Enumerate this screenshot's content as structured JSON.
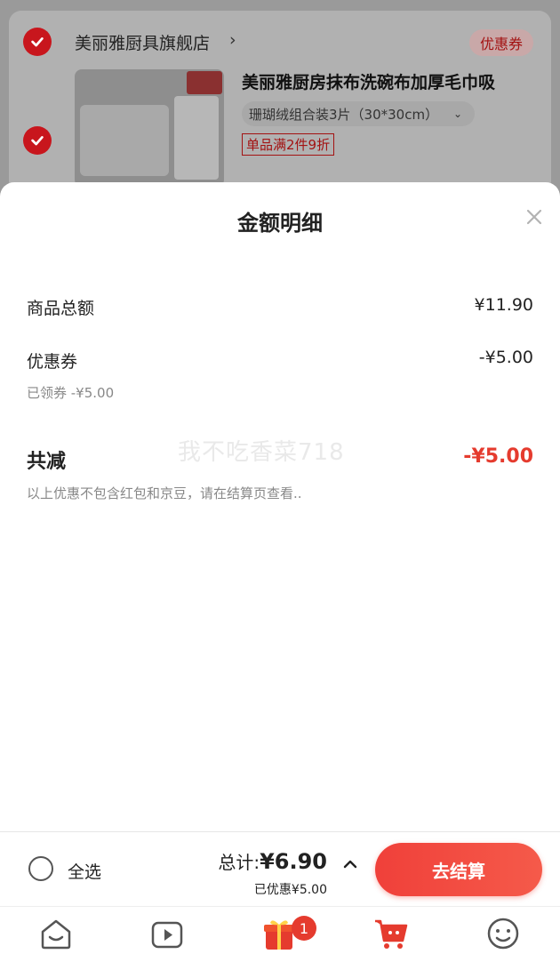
{
  "store": {
    "name": "美丽雅厨具旗舰店",
    "chevron": "›",
    "coupon_label": "优惠券"
  },
  "product": {
    "title": "美丽雅厨房抹布洗碗布加厚毛巾吸",
    "variant": "珊瑚绒组合装3片（30*30cm）",
    "promo": "单品满2件9折"
  },
  "sheet": {
    "title": "金额明细",
    "rows": [
      {
        "label": "商品总额",
        "value": "¥11.90"
      },
      {
        "label": "优惠券",
        "value": "-¥5.00",
        "sub": "已领券 -¥5.00"
      }
    ],
    "total_label": "共减",
    "total_value": "-¥5.00",
    "note": "以上优惠不包含红包和京豆，请在结算页查看..",
    "watermark": "我不吃香菜718"
  },
  "bottom": {
    "select_all": "全选",
    "total_prefix": "总计:",
    "total_amount": "¥6.90",
    "discount": "已优惠¥5.00",
    "checkout": "去结算"
  },
  "tabbar": {
    "badge_count": "1"
  },
  "colors": {
    "accent": "#e53b2e",
    "brand_red": "#c8161d"
  }
}
